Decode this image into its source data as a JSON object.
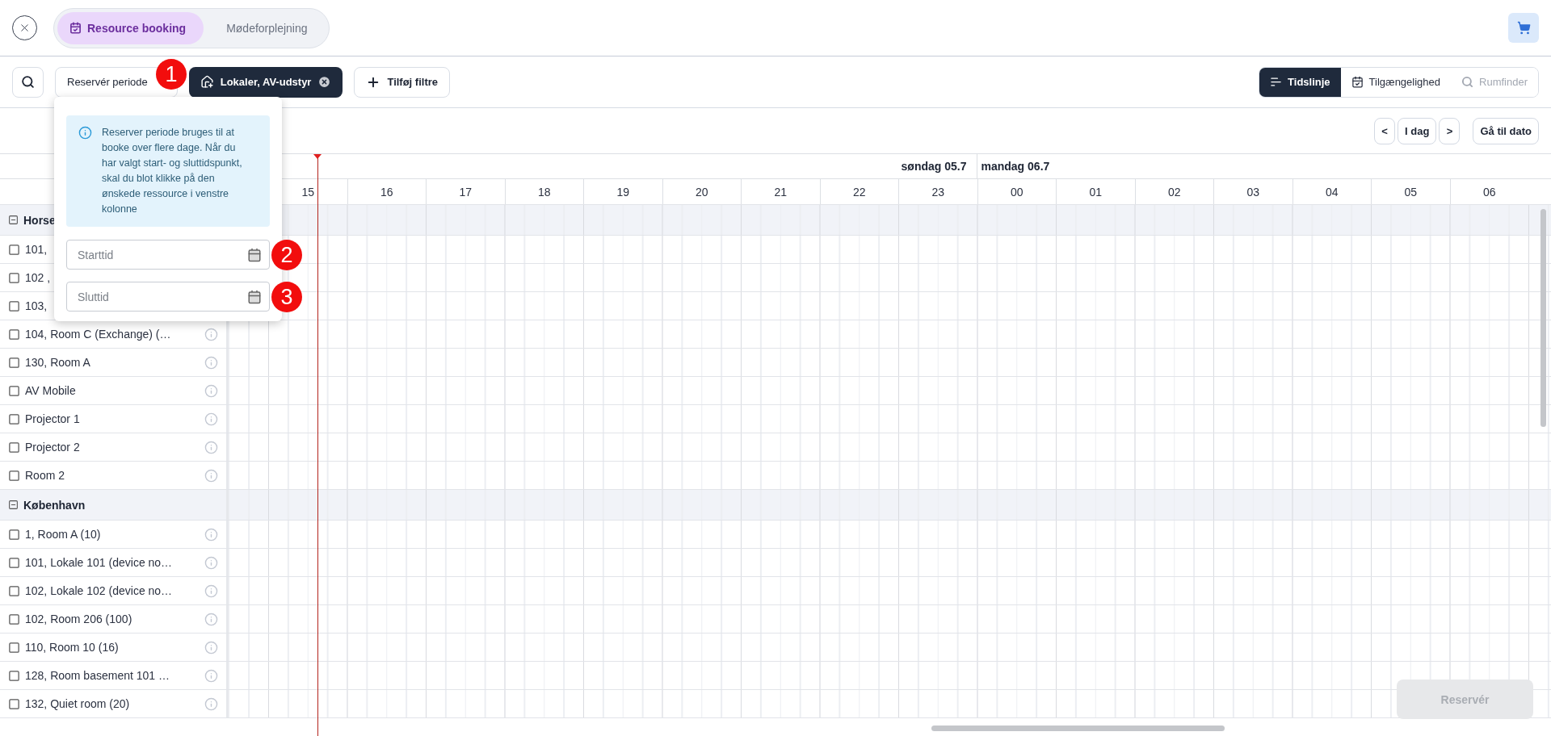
{
  "header": {
    "tabs": [
      {
        "label": "Resource booking",
        "selected": true
      },
      {
        "label": "Mødeforplejning",
        "selected": false
      }
    ]
  },
  "toolbar": {
    "period_button": "Reservér periode",
    "filter_chip": "Lokaler, AV-udstyr",
    "add_filter": "Tilføj filtre",
    "views": [
      {
        "label": "Tidslinje",
        "selected": true,
        "disabled": false
      },
      {
        "label": "Tilgængelighed",
        "selected": false,
        "disabled": false
      },
      {
        "label": "Rumfinder",
        "selected": false,
        "disabled": true
      }
    ]
  },
  "annotations": [
    "1",
    "2",
    "3"
  ],
  "period_popup": {
    "info": "Reserver periode bruges til at booke over flere dage. Når du har valgt start- og sluttidspunkt, skal du blot klikke på den ønskede ressource i venstre kolonne",
    "fields": [
      {
        "placeholder": "Starttid"
      },
      {
        "placeholder": "Sluttid"
      }
    ]
  },
  "navigation": {
    "prev": "<",
    "today": "I dag",
    "next": ">",
    "goto": "Gå til dato"
  },
  "timeline": {
    "days": [
      {
        "label": "søndag 05.7",
        "hours": [
          "15",
          "16",
          "17",
          "18",
          "19",
          "20",
          "21",
          "22",
          "23"
        ]
      },
      {
        "label": "mandag 06.7",
        "hours": [
          "00",
          "01",
          "02",
          "03",
          "04",
          "05",
          "06"
        ]
      }
    ]
  },
  "groups": [
    {
      "name": "Horse",
      "expanded": true,
      "resources": [
        {
          "name": "101,",
          "checked": false
        },
        {
          "name": "102 ,",
          "checked": false
        },
        {
          "name": "103,",
          "checked": false
        },
        {
          "name": "104, Room C (Exchange) (…",
          "checked": false
        },
        {
          "name": "130, Room A",
          "checked": false
        },
        {
          "name": "AV Mobile",
          "checked": false
        },
        {
          "name": "Projector 1",
          "checked": false
        },
        {
          "name": "Projector 2",
          "checked": false
        },
        {
          "name": "Room 2",
          "checked": false
        }
      ]
    },
    {
      "name": "København",
      "expanded": true,
      "resources": [
        {
          "name": "1, Room A (10)",
          "checked": false
        },
        {
          "name": "101, Lokale 101 (device no…",
          "checked": false
        },
        {
          "name": "102, Lokale 102 (device no…",
          "checked": false
        },
        {
          "name": "102, Room 206 (100)",
          "checked": false
        },
        {
          "name": "110, Room 10 (16)",
          "checked": false
        },
        {
          "name": "128, Room basement 101 …",
          "checked": false
        },
        {
          "name": "132, Quiet room (20)",
          "checked": false
        }
      ]
    }
  ],
  "reserve_button": {
    "label": "Reservér",
    "disabled": true
  }
}
